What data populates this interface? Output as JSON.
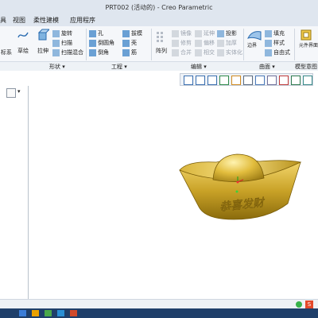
{
  "window": {
    "title": "PRT002 (活动的) - Creo Parametric"
  },
  "tabs": [
    "具",
    "视图",
    "柔性建模",
    "应用程序"
  ],
  "ribbon": {
    "coord_label": "标系",
    "sketch_label": "草绘",
    "extrude_label": "拉伸",
    "rotate_label": "旋转",
    "sweep_label": "扫描",
    "sweep_blend_label": "扫描混合",
    "hole_label": "孔",
    "round_label": "倒圆角",
    "chamfer_label": "倒角",
    "draft_label": "拔模",
    "shell_label": "壳",
    "rib_label": "筋",
    "pattern_label": "阵列",
    "copy_label": "镜像",
    "extend_label": "延伸",
    "project_label": "投影",
    "trim_label": "修剪",
    "offset_label": "偏移",
    "thicken_label": "加厚",
    "merge_label": "合并",
    "intersect_label": "相交",
    "solidify_label": "实体化",
    "fill_label": "填充",
    "boundary_label": "边界",
    "style_label": "样式",
    "freeform_label": "自由式",
    "component_interface_label": "元件界面"
  },
  "groups": {
    "shape": "形状",
    "engineering": "工程",
    "editing": "编辑",
    "surfaces": "曲面",
    "model_intent": "模型意图"
  },
  "graphics_toolbar": {
    "icons": [
      "zoom-fit-icon",
      "zoom-in-icon",
      "zoom-out-icon",
      "repaint-icon",
      "spin-center-icon",
      "view-manager-icon",
      "display-style-icon",
      "saved-views-icon",
      "datum-display-icon",
      "annotation-icon",
      "spin-icon"
    ]
  },
  "model": {
    "engraving_text": "恭喜发财",
    "colors": {
      "gold": "#c9a227",
      "gold_dark": "#8a6b0c",
      "gold_light": "#f2d56b"
    }
  },
  "status": {
    "badge": "S"
  }
}
